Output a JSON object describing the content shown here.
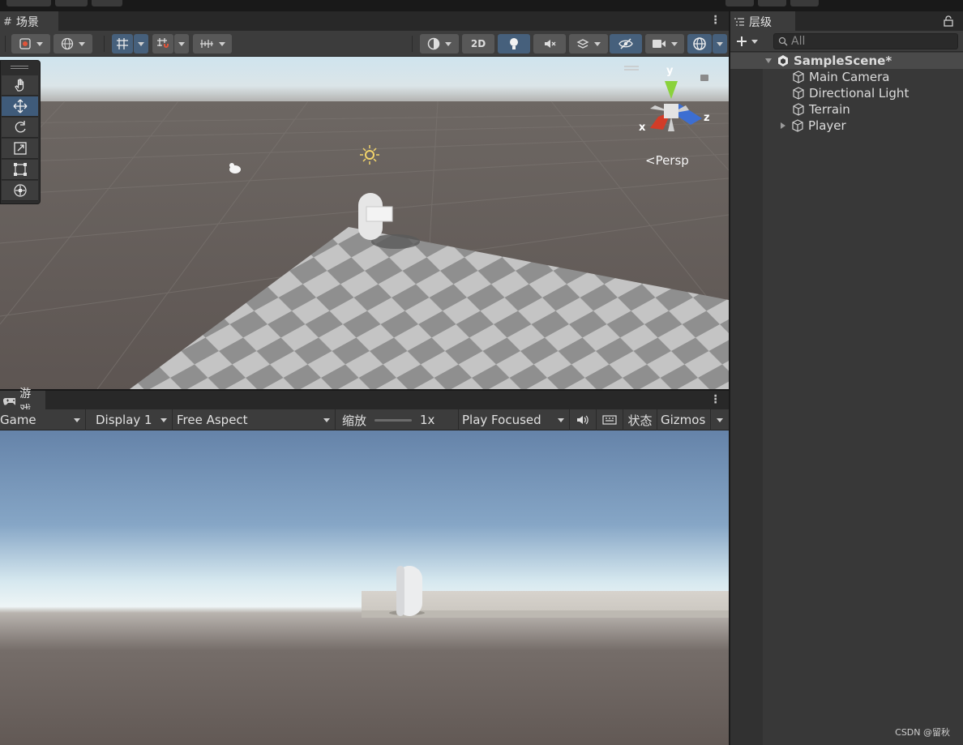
{
  "scene_tab": {
    "label": "场景"
  },
  "scene_toolbar": {
    "mode_2d": "2D"
  },
  "scene_gizmo": {
    "axis_x": "x",
    "axis_y": "y",
    "axis_z": "z",
    "projection": "<Persp"
  },
  "game_tab": {
    "label": "游戏"
  },
  "game_toolbar": {
    "view_select": "Game",
    "display_select": "Display 1",
    "aspect_select": "Free Aspect",
    "scale_label": "缩放",
    "scale_value": "1x",
    "play_mode_select": "Play Focused",
    "stats_label": "状态",
    "gizmos_label": "Gizmos"
  },
  "hierarchy": {
    "tab_label": "层级",
    "search_placeholder": "All",
    "scene_name": "SampleScene*",
    "items": [
      {
        "label": "Main Camera"
      },
      {
        "label": "Directional Light"
      },
      {
        "label": "Terrain"
      },
      {
        "label": "Player"
      }
    ]
  },
  "watermark": "CSDN @留秋",
  "colors": {
    "panel_bg": "#383838",
    "toolbar_bg": "#3c3c3c",
    "active_blue": "#46607c",
    "axis_x": "#d23c28",
    "axis_y": "#8ad23c",
    "axis_z": "#3c6ed2"
  }
}
